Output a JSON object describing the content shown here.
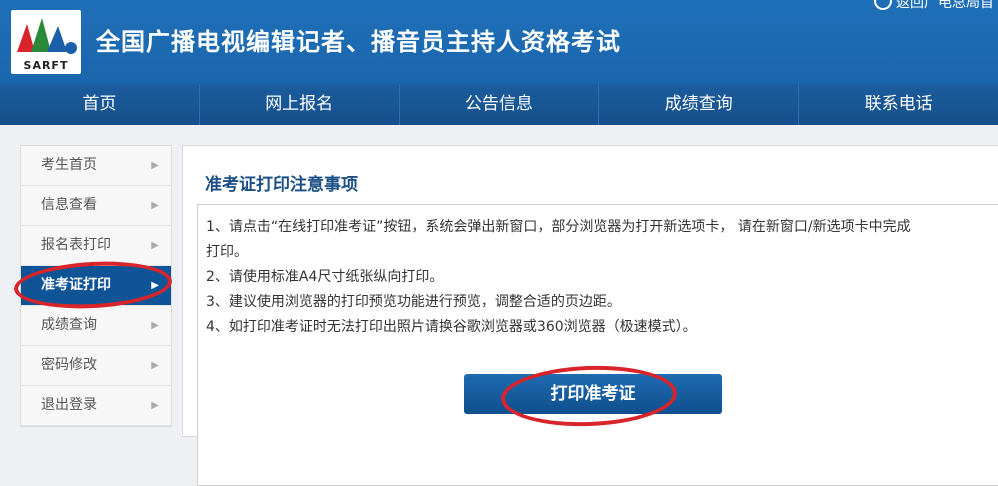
{
  "header": {
    "logo_text": "SARFT",
    "title": "全国广播电视编辑记者、播音员主持人资格考试",
    "top_link": "返回广电总局首"
  },
  "nav": {
    "items": [
      "首页",
      "网上报名",
      "公告信息",
      "成绩查询",
      "联系电话"
    ]
  },
  "sidebar": {
    "items": [
      {
        "label": "考生首页"
      },
      {
        "label": "信息查看"
      },
      {
        "label": "报名表打印"
      },
      {
        "label": "准考证打印",
        "active": true
      },
      {
        "label": "成绩查询"
      },
      {
        "label": "密码修改"
      },
      {
        "label": "退出登录"
      }
    ]
  },
  "main": {
    "title": "准考证打印注意事项",
    "lines": [
      "1、请点击“在线打印准考证”按钮，系统会弹出新窗口，部分浏览器为打开新选项卡， 请在新窗口/新选项卡中完成",
      "打印。",
      "2、请使用标准A4尺寸纸张纵向打印。",
      "3、建议使用浏览器的打印预览功能进行预览，调整合适的页边距。",
      "4、如打印准考证时无法打印出照片请换谷歌浏览器或360浏览器（极速模式）。"
    ],
    "print_button": "打印准考证"
  },
  "colors": {
    "header_blue": "#1f6fb8",
    "nav_blue": "#164f8a",
    "active_blue": "#0f5496",
    "annotation_red": "#d8242a"
  }
}
